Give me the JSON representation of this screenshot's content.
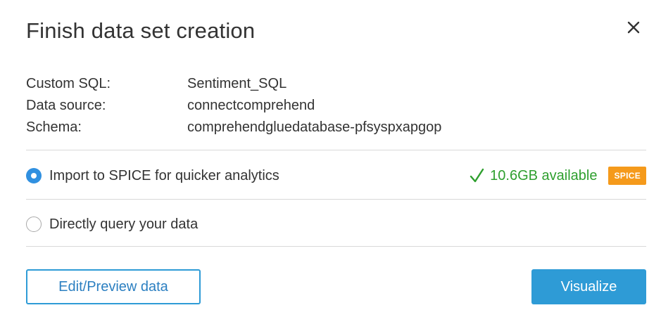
{
  "dialog": {
    "title": "Finish data set creation",
    "close_icon": "close-icon"
  },
  "details": [
    {
      "label": "Custom SQL:",
      "value": "Sentiment_SQL"
    },
    {
      "label": "Data source:",
      "value": "connectcomprehend"
    },
    {
      "label": "Schema:",
      "value": "comprehendgluedatabase-pfsyspxapgop"
    }
  ],
  "options": {
    "spice": {
      "label": "Import to SPICE for quicker analytics",
      "selected": true,
      "available_text": "10.6GB available",
      "badge": "SPICE"
    },
    "direct": {
      "label": "Directly query your data",
      "selected": false
    }
  },
  "buttons": {
    "edit_preview": "Edit/Preview data",
    "visualize": "Visualize"
  },
  "colors": {
    "accent": "#2e9bd6",
    "radio_selected": "#3090e0",
    "available_green": "#2e9f2e",
    "spice_badge": "#f59a1b"
  }
}
